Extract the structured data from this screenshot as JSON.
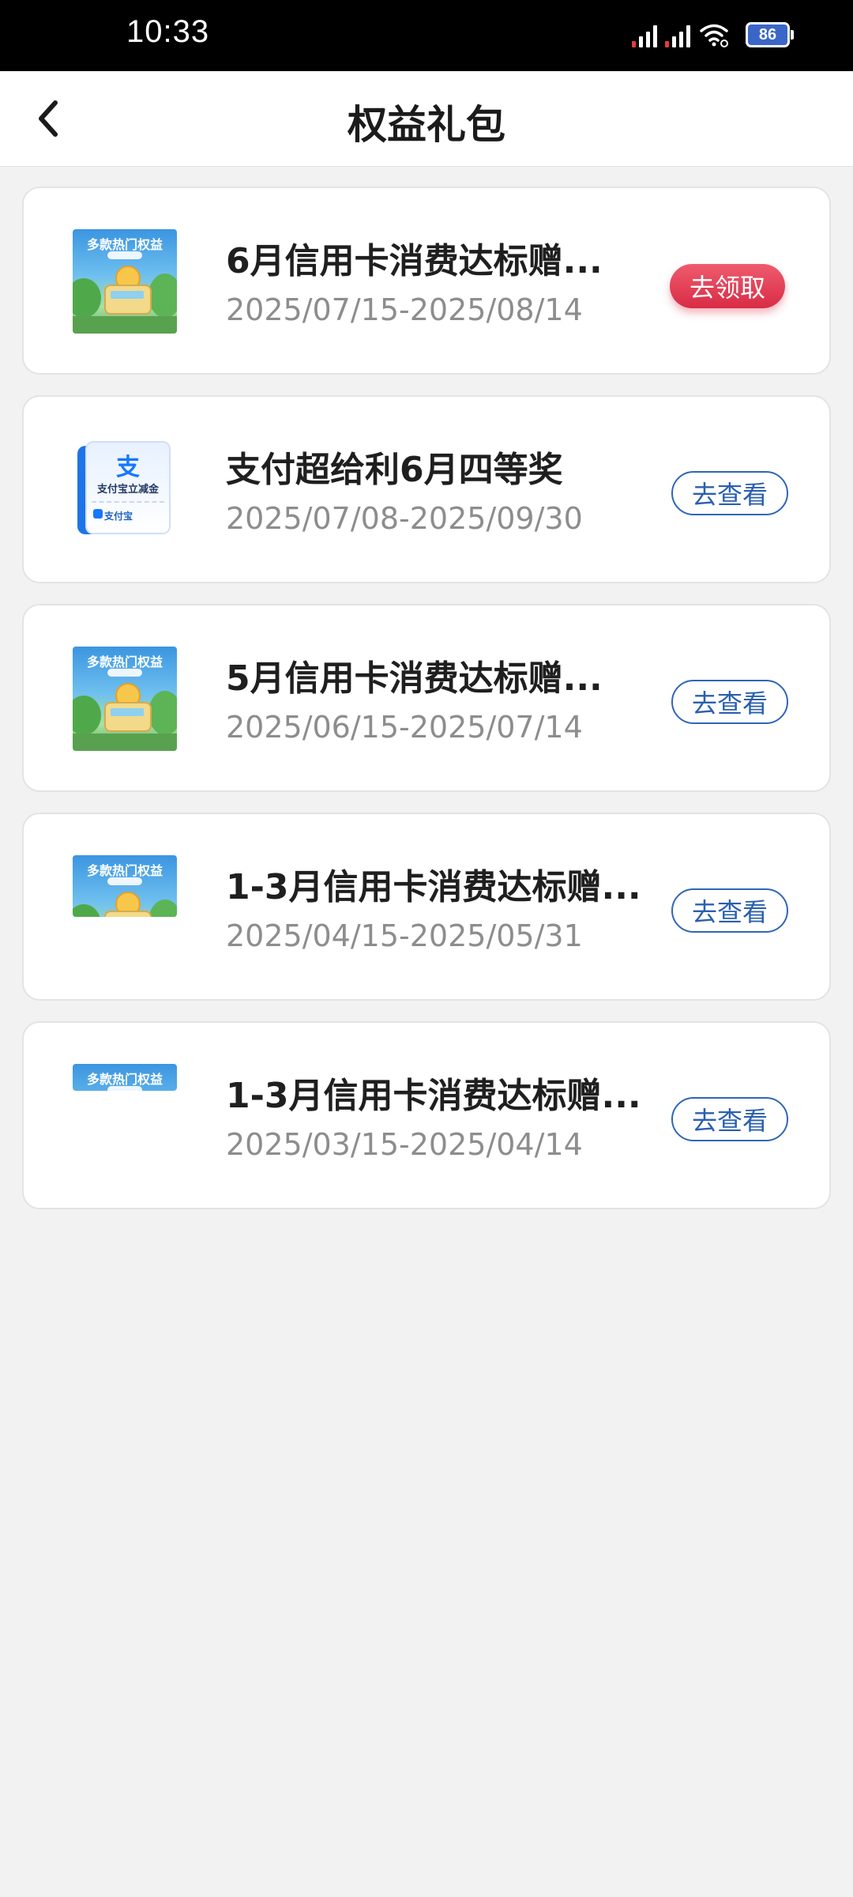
{
  "status_bar": {
    "time": "10:33",
    "battery": "86"
  },
  "header": {
    "title": "权益礼包"
  },
  "cards": [
    {
      "title": "6月信用卡消费达标赠...",
      "date_range": "2025/07/15-2025/08/14",
      "button": "去领取",
      "thumb_title": "多款热门权益"
    },
    {
      "title": "支付超给利6月四等奖",
      "date_range": "2025/07/08-2025/09/30",
      "button": "去查看",
      "thumb_icon": "支",
      "thumb_title": "支付宝立减金",
      "thumb_brand": "支付宝"
    },
    {
      "title": "5月信用卡消费达标赠...",
      "date_range": "2025/06/15-2025/07/14",
      "button": "去查看",
      "thumb_title": "多款热门权益"
    },
    {
      "title": "1-3月信用卡消费达标赠...",
      "date_range": "2025/04/15-2025/05/31",
      "button": "去查看",
      "thumb_title": "多款热门权益"
    },
    {
      "title": "1-3月信用卡消费达标赠...",
      "date_range": "2025/03/15-2025/04/14",
      "button": "去查看",
      "thumb_title": "多款热门权益"
    }
  ],
  "colors": {
    "claim_button": "#dc3450",
    "view_button_border": "#2f66b8"
  }
}
